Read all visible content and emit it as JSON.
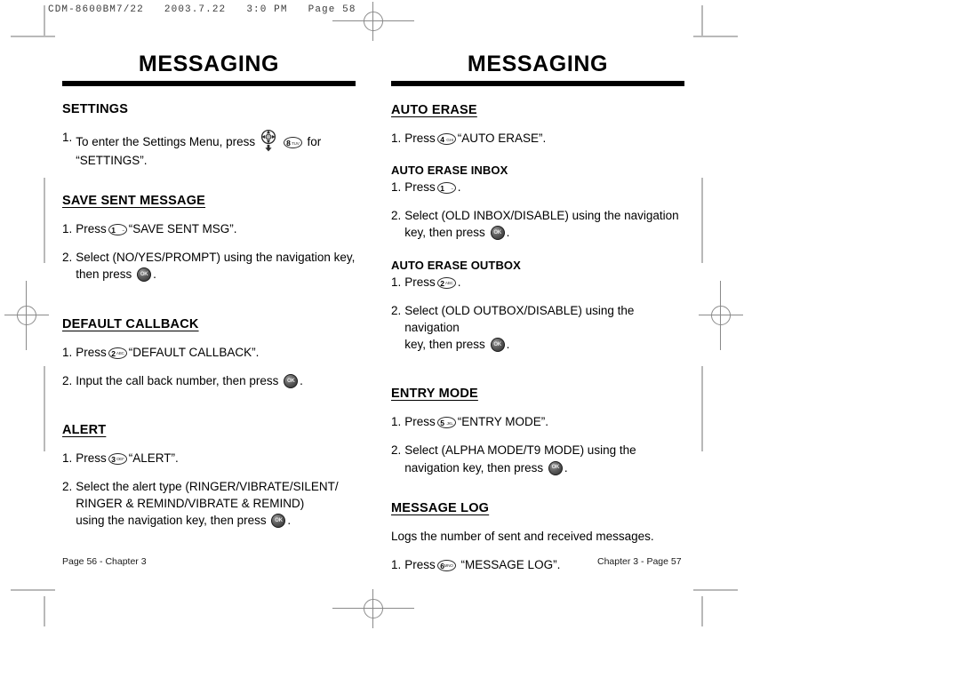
{
  "scan_header": "CDM-8600BM7/22   2003.7.22   3:0 PM   Page 58",
  "keys": {
    "nav": "navigation-key",
    "ok": "OK",
    "k1_num": "1",
    "k1_sub": "~",
    "k2_num": "2",
    "k2_sub": "ABC",
    "k3_num": "3",
    "k3_sub": "DEF",
    "k4_num": "4",
    "k4_sub": "GHI",
    "k5_num": "5",
    "k5_sub": "JKL",
    "k6_num": "6",
    "k6_sub": "MNO",
    "k8_num": "8",
    "k8_sub": "TUV"
  },
  "left_page": {
    "title": "MESSAGING",
    "settings": {
      "heading": "SETTINGS",
      "step1_num": "1.",
      "step1_a": "To enter the Settings Menu, press",
      "step1_b": "for",
      "step1_c": "“SETTINGS”."
    },
    "save_sent_message": {
      "heading": "SAVE SENT MESSAGE",
      "step1_num": "1.",
      "step1_a": "Press",
      "step1_b": "“SAVE SENT MSG”.",
      "step2_num": "2.",
      "step2_a": "Select (NO/YES/PROMPT) using the navigation key,",
      "step2_b": "then press",
      "step2_c": "."
    },
    "default_callback": {
      "heading": "DEFAULT CALLBACK",
      "step1_num": "1.",
      "step1_a": "Press",
      "step1_b": "“DEFAULT CALLBACK”.",
      "step2_num": "2.",
      "step2_a": "Input the call back number, then press",
      "step2_b": "."
    },
    "alert": {
      "heading": "ALERT",
      "step1_num": "1.",
      "step1_a": "Press",
      "step1_b": "“ALERT”.",
      "step2_num": "2.",
      "step2_a": "Select the alert type (RINGER/VIBRATE/SILENT/",
      "step2_b": "RINGER & REMIND/VIBRATE & REMIND)",
      "step2_c": "using the navigation key, then press",
      "step2_d": "."
    },
    "footer": "Page 56 - Chapter 3"
  },
  "right_page": {
    "title": "MESSAGING",
    "auto_erase": {
      "heading": "AUTO ERASE",
      "step1_num": "1.",
      "step1_a": "Press",
      "step1_b": "“AUTO ERASE”."
    },
    "auto_erase_inbox": {
      "heading": "AUTO ERASE INBOX",
      "step1_num": "1.",
      "step1_a": "Press",
      "step1_b": ".",
      "step2_num": "2.",
      "step2_a": "Select (OLD INBOX/DISABLE) using the navigation",
      "step2_b": "key, then press",
      "step2_c": "."
    },
    "auto_erase_outbox": {
      "heading": "AUTO ERASE OUTBOX",
      "step1_num": "1.",
      "step1_a": "Press",
      "step1_b": ".",
      "step2_num": "2.",
      "step2_a": "Select (OLD OUTBOX/DISABLE) using the navigation",
      "step2_b": "key, then press",
      "step2_c": "."
    },
    "entry_mode": {
      "heading": "ENTRY MODE",
      "step1_num": "1.",
      "step1_a": "Press",
      "step1_b": "“ENTRY MODE”.",
      "step2_num": "2.",
      "step2_a": "Select (ALPHA MODE/T9 MODE) using the",
      "step2_b": "navigation key, then press",
      "step2_c": "."
    },
    "message_log": {
      "heading": "MESSAGE LOG",
      "description": "Logs the number of sent and received messages.",
      "step1_num": "1.",
      "step1_a": "Press",
      "step1_b": "“MESSAGE LOG”."
    },
    "footer": "Chapter 3 - Page 57"
  }
}
